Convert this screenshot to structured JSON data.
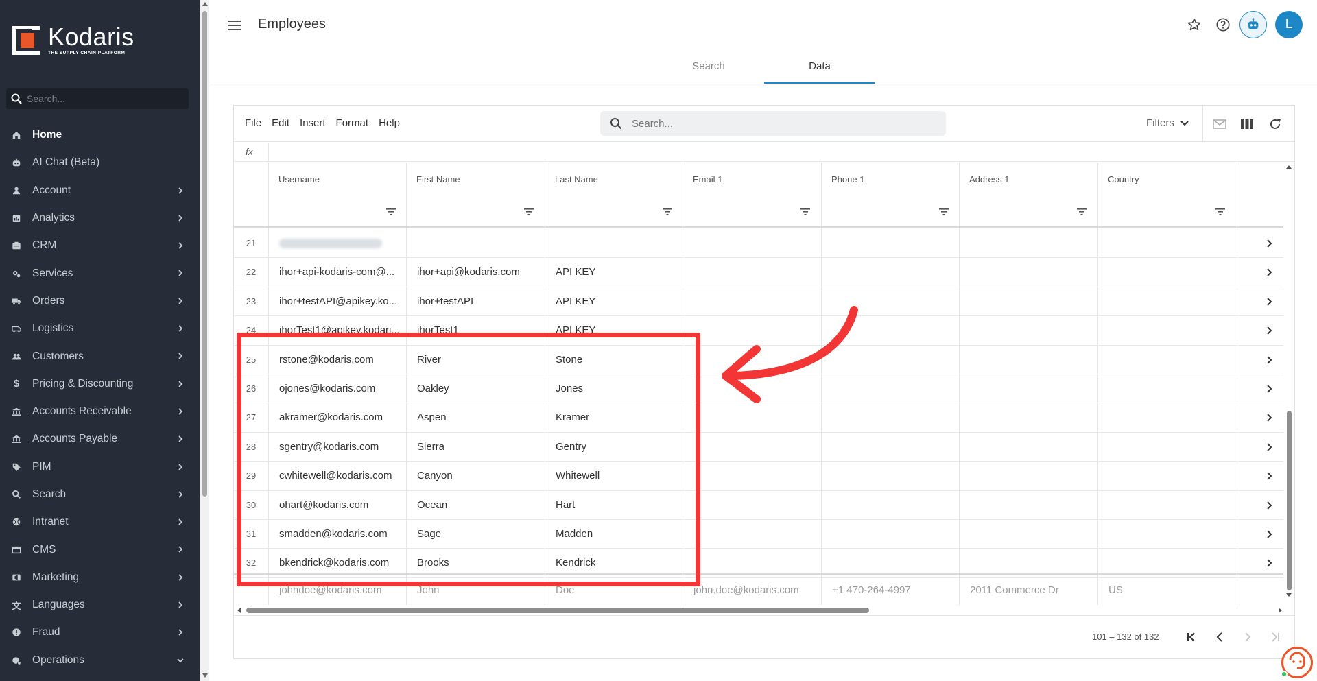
{
  "brand": {
    "name": "Kodaris",
    "tagline": "THE SUPPLY CHAIN PLATFORM",
    "accent": "#1e88c7",
    "logo_orange": "#e8562a"
  },
  "sidebar": {
    "search_placeholder": "Search...",
    "items": [
      {
        "label": "Home",
        "icon": "home-icon",
        "active": true
      },
      {
        "label": "AI Chat (Beta)",
        "icon": "robot-icon"
      },
      {
        "label": "Account",
        "icon": "user-icon"
      },
      {
        "label": "Analytics",
        "icon": "chart-icon"
      },
      {
        "label": "CRM",
        "icon": "crm-icon"
      },
      {
        "label": "Services",
        "icon": "gears-icon"
      },
      {
        "label": "Orders",
        "icon": "truck-icon"
      },
      {
        "label": "Logistics",
        "icon": "van-icon"
      },
      {
        "label": "Customers",
        "icon": "users-icon"
      },
      {
        "label": "Pricing & Discounting",
        "icon": "dollar-icon"
      },
      {
        "label": "Accounts Receivable",
        "icon": "bank-icon"
      },
      {
        "label": "Accounts Payable",
        "icon": "bank-icon"
      },
      {
        "label": "PIM",
        "icon": "tag-icon"
      },
      {
        "label": "Search",
        "icon": "search-icon"
      },
      {
        "label": "Intranet",
        "icon": "globe-icon"
      },
      {
        "label": "CMS",
        "icon": "window-icon"
      },
      {
        "label": "Marketing",
        "icon": "megaphone-icon"
      },
      {
        "label": "Languages",
        "icon": "translate-icon"
      },
      {
        "label": "Fraud",
        "icon": "alert-icon"
      },
      {
        "label": "Operations",
        "icon": "ops-icon"
      }
    ]
  },
  "header": {
    "title": "Employees",
    "tabs": [
      {
        "label": "Search"
      },
      {
        "label": "Data",
        "active": true
      }
    ],
    "avatar_initial": "L"
  },
  "toolbar": {
    "menus": [
      "File",
      "Edit",
      "Insert",
      "Format",
      "Help"
    ],
    "search_placeholder": "Search...",
    "filters_label": "Filters",
    "fx_label": "fx"
  },
  "grid": {
    "columns": [
      "Username",
      "First Name",
      "Last Name",
      "Email 1",
      "Phone 1",
      "Address 1",
      "Country"
    ],
    "rows": [
      {
        "n": "21",
        "username": "",
        "first": "",
        "last": "",
        "redacted": true
      },
      {
        "n": "22",
        "username": "ihor+api-kodaris-com@...",
        "first": "ihor+api@kodaris.com",
        "last": "API KEY"
      },
      {
        "n": "23",
        "username": "ihor+testAPI@apikey.ko...",
        "first": "ihor+testAPI",
        "last": "API KEY"
      },
      {
        "n": "24",
        "username": "ihorTest1@apikey.kodari...",
        "first": "ihorTest1",
        "last": "API KEY"
      },
      {
        "n": "25",
        "username": "rstone@kodaris.com",
        "first": "River",
        "last": "Stone"
      },
      {
        "n": "26",
        "username": "ojones@kodaris.com",
        "first": "Oakley",
        "last": "Jones"
      },
      {
        "n": "27",
        "username": "akramer@kodaris.com",
        "first": "Aspen",
        "last": "Kramer"
      },
      {
        "n": "28",
        "username": "sgentry@kodaris.com",
        "first": "Sierra",
        "last": "Gentry"
      },
      {
        "n": "29",
        "username": "cwhitewell@kodaris.com",
        "first": "Canyon",
        "last": "Whitewell"
      },
      {
        "n": "30",
        "username": "ohart@kodaris.com",
        "first": "Ocean",
        "last": "Hart"
      },
      {
        "n": "31",
        "username": "smadden@kodaris.com",
        "first": "Sage",
        "last": "Madden"
      },
      {
        "n": "32",
        "username": "bkendrick@kodaris.com",
        "first": "Brooks",
        "last": "Kendrick"
      }
    ],
    "new_row": {
      "username": "johndoe@kodaris.com",
      "first": "John",
      "last": "Doe",
      "email": "john.doe@kodaris.com",
      "phone": "+1 470-264-4997",
      "address": "2011 Commerce Dr",
      "country": "US"
    }
  },
  "pager": {
    "range": "101 – 132 of 132"
  },
  "annotation": {
    "color": "#f23535"
  }
}
